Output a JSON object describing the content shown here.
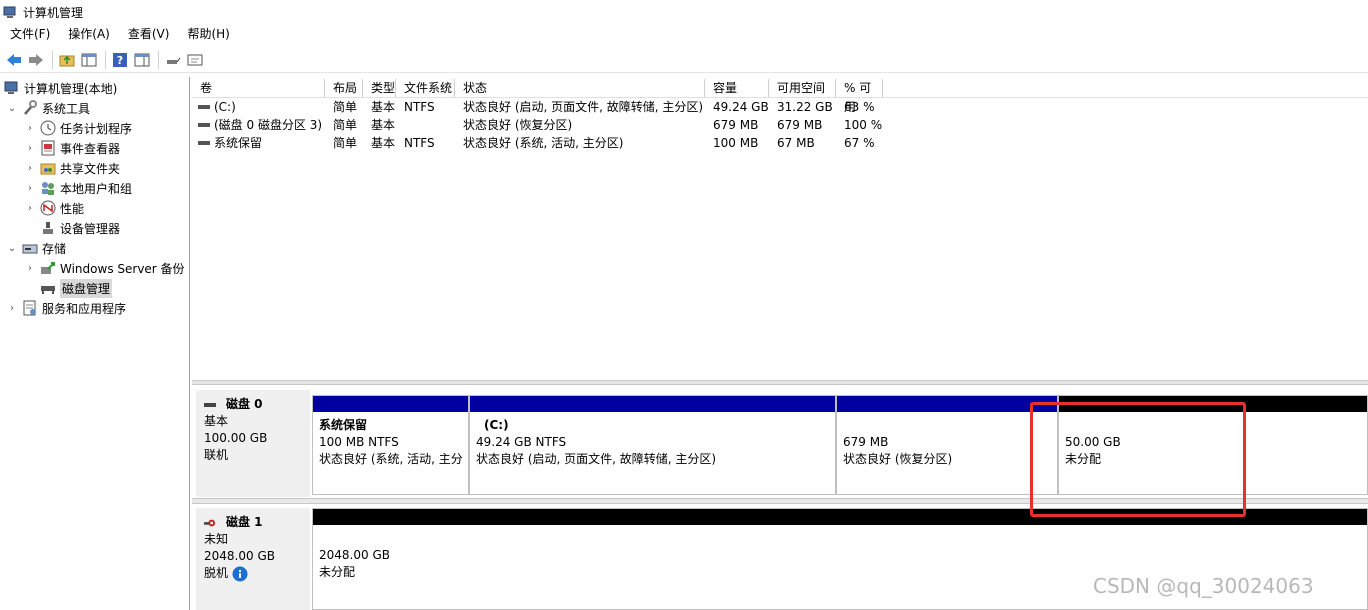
{
  "window": {
    "title": "计算机管理"
  },
  "menu": [
    "文件(F)",
    "操作(A)",
    "查看(V)",
    "帮助(H)"
  ],
  "tree": {
    "root": "计算机管理(本地)",
    "system_tools": "系统工具",
    "task_scheduler": "任务计划程序",
    "event_viewer": "事件查看器",
    "shared_folders": "共享文件夹",
    "local_users": "本地用户和组",
    "performance": "性能",
    "device_manager": "设备管理器",
    "storage": "存储",
    "windows_backup": "Windows Server 备份",
    "disk_management": "磁盘管理",
    "services_apps": "服务和应用程序"
  },
  "volume_table": {
    "headers": [
      "卷",
      "布局",
      "类型",
      "文件系统",
      "状态",
      "容量",
      "可用空间",
      "% 可用"
    ],
    "rows": [
      [
        "(C:)",
        "简单",
        "基本",
        "NTFS",
        "状态良好 (启动, 页面文件, 故障转储, 主分区)",
        "49.24 GB",
        "31.22 GB",
        "63 %"
      ],
      [
        "(磁盘 0 磁盘分区 3)",
        "简单",
        "基本",
        "",
        "状态良好 (恢复分区)",
        "679 MB",
        "679 MB",
        "100 %"
      ],
      [
        "系统保留",
        "简单",
        "基本",
        "NTFS",
        "状态良好 (系统, 活动, 主分区)",
        "100 MB",
        "67 MB",
        "67 %"
      ]
    ]
  },
  "disks": [
    {
      "name": "磁盘 0",
      "type": "基本",
      "size": "100.00 GB",
      "status": "联机",
      "partitions": [
        {
          "name": "系统保留",
          "size": "100 MB NTFS",
          "status": "状态良好 (系统, 活动, 主分",
          "bar": "#0000a0"
        },
        {
          "name": "(C:)",
          "size": "49.24 GB NTFS",
          "status": "状态良好 (启动, 页面文件, 故障转储, 主分区)",
          "bar": "#0000a0"
        },
        {
          "name": "",
          "size": "679 MB",
          "status": "状态良好 (恢复分区)",
          "bar": "#0000a0"
        },
        {
          "name": "",
          "size": "50.00 GB",
          "status": "未分配",
          "bar": "#000000"
        }
      ]
    },
    {
      "name": "磁盘 1",
      "type": "未知",
      "size": "2048.00 GB",
      "status": "脱机",
      "partitions": [
        {
          "name": "",
          "size": "2048.00 GB",
          "status": "未分配",
          "bar": "#000000"
        }
      ]
    }
  ],
  "watermark": "CSDN @qq_30024063",
  "colors": {
    "primary_partition": "#0000a0",
    "unallocated": "#000000",
    "highlight": "#e8302c"
  }
}
